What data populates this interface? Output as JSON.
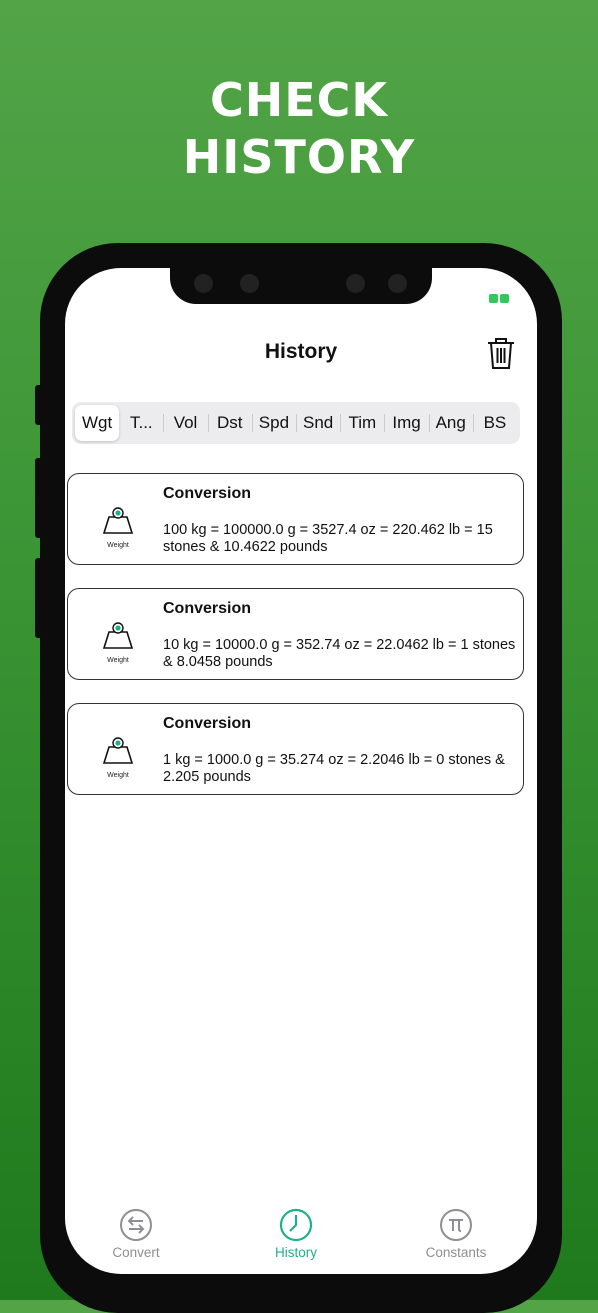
{
  "promo": {
    "line1": "CHECK",
    "line2": "HISTORY"
  },
  "header": {
    "title": "History"
  },
  "segments": [
    "Wgt",
    "T...",
    "Vol",
    "Dst",
    "Spd",
    "Snd",
    "Tim",
    "Img",
    "Ang",
    "BS"
  ],
  "history": [
    {
      "title": "Conversion",
      "icon_label": "Weight",
      "text": "100 kg = 100000.0 g = 3527.4 oz =  220.462 lb = 15 stones & 10.4622 pounds"
    },
    {
      "title": "Conversion",
      "icon_label": "Weight",
      "text": "10 kg = 10000.0 g = 352.74 oz =  22.0462 lb = 1 stones & 8.0458 pounds"
    },
    {
      "title": "Conversion",
      "icon_label": "Weight",
      "text": "1 kg = 1000.0 g = 35.274 oz =  2.2046 lb = 0 stones & 2.205 pounds"
    }
  ],
  "tabbar": {
    "convert": "Convert",
    "history": "History",
    "constants": "Constants",
    "active": "history"
  },
  "colors": {
    "accent": "#1fb08c",
    "background_top": "#52a447",
    "background_bottom": "#1e7a1c"
  }
}
